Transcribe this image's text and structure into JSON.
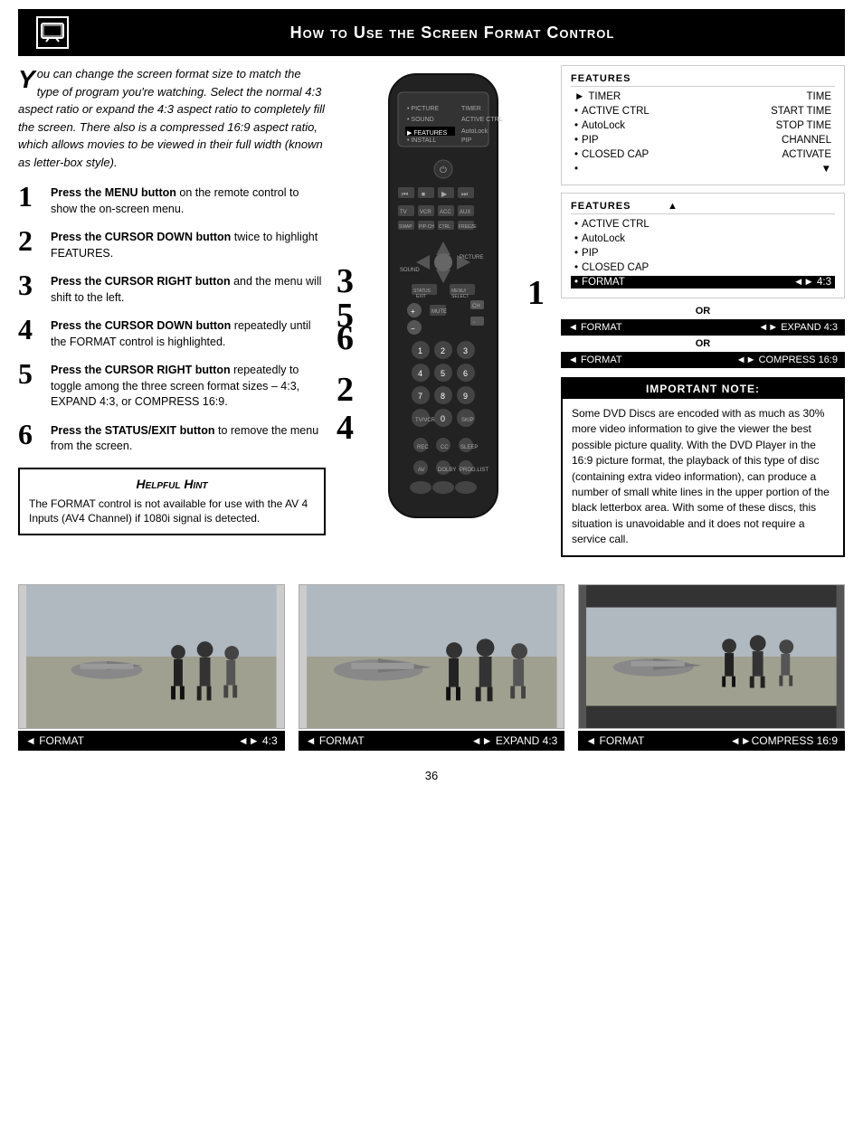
{
  "header": {
    "title": "How to Use the Screen Format Control",
    "icon": "📺"
  },
  "intro": {
    "text": "ou can change the screen format size to match the type of program you're watching. Select the normal 4:3 aspect ratio or expand the 4:3 aspect ratio to completely fill the screen. There also is a compressed 16:9 aspect ratio, which allows movies to be viewed in their full width (known as letter-box style).",
    "drop_cap": "Y"
  },
  "steps": [
    {
      "num": "1",
      "bold": "Press the MENU button",
      "text": " on the remote control to show the on-screen menu."
    },
    {
      "num": "2",
      "bold": "Press the CURSOR DOWN button",
      "text": " twice to highlight FEATURES."
    },
    {
      "num": "3",
      "bold": "Press the CURSOR RIGHT button",
      "text": " and the menu will shift to the left."
    },
    {
      "num": "4",
      "bold": "Press the CURSOR DOWN button",
      "text": " repeatedly until the FORMAT control is highlighted."
    },
    {
      "num": "5",
      "bold": "Press the CURSOR RIGHT button",
      "text": " repeatedly to toggle among the three screen format sizes – 4:3, EXPAND 4:3, or COMPRESS 16:9."
    },
    {
      "num": "6",
      "bold": "Press the STATUS/EXIT button",
      "text": " to remove the menu from the screen."
    }
  ],
  "hint": {
    "title": "Helpful Hint",
    "text": "The FORMAT control is not available for use with the AV 4 Inputs (AV4 Channel) if 1080i signal is detected."
  },
  "menu1": {
    "title": "FEATURES",
    "items": [
      {
        "bullet": "►",
        "label": "TIMER",
        "right": "TIME"
      },
      {
        "bullet": "•",
        "label": "ACTIVE CTRL",
        "right": "START TIME"
      },
      {
        "bullet": "•",
        "label": "AutoLock",
        "right": "STOP TIME"
      },
      {
        "bullet": "•",
        "label": "PIP",
        "right": "CHANNEL"
      },
      {
        "bullet": "•",
        "label": "CLOSED CAP",
        "right": "ACTIVATE"
      },
      {
        "bullet": "•",
        "label": "",
        "right": "▼"
      }
    ]
  },
  "menu2": {
    "title": "FEATURES",
    "items": [
      {
        "bullet": "",
        "label": "▲",
        "right": ""
      },
      {
        "bullet": "•",
        "label": "ACTIVE CTRL",
        "right": ""
      },
      {
        "bullet": "•",
        "label": "AutoLock",
        "right": ""
      },
      {
        "bullet": "•",
        "label": "PIP",
        "right": ""
      },
      {
        "bullet": "•",
        "label": "CLOSED CAP",
        "right": ""
      },
      {
        "bullet": "•",
        "label": "FORMAT",
        "right": "◄► 4:3",
        "highlighted": true
      }
    ]
  },
  "format_bars": [
    {
      "left": "◄ FORMAT",
      "right": "◄► EXPAND 4:3"
    },
    {
      "left": "◄ FORMAT",
      "right": "◄► COMPRESS 16:9"
    }
  ],
  "important_note": {
    "title": "IMPORTANT NOTE:",
    "text": "Some DVD Discs are encoded with as much as 30% more video information to give the viewer the best possible picture quality. With the DVD Player in the 16:9 picture format, the playback of this type of disc (containing extra video information), can produce a number of small white lines in the upper portion of the black letterbox area. With some of these discs, this situation is unavoidable and it does not require a service call."
  },
  "bottom_images": [
    {
      "format_left": "◄ FORMAT",
      "format_right": "◄► 4:3",
      "dark": false
    },
    {
      "format_left": "◄ FORMAT",
      "format_right": "◄► EXPAND 4:3",
      "dark": false
    },
    {
      "format_left": "◄ FORMAT",
      "format_right": "◄►COMPRESS 16:9",
      "dark": true
    }
  ],
  "page_number": "36",
  "step_overlays": {
    "s3_5": "3\n5",
    "s1": "1",
    "s6": "6",
    "s2": "2",
    "s4": "4"
  }
}
